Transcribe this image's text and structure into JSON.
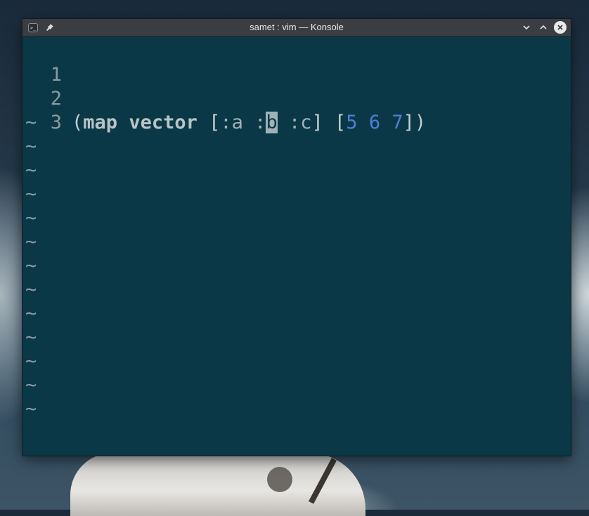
{
  "window": {
    "title": "samet : vim — Konsole",
    "app_icon": "terminal-icon",
    "pin_icon": "pin-icon",
    "minimize_icon": "chevron-down-icon",
    "maximize_icon": "chevron-up-icon",
    "close_icon": "close-icon"
  },
  "editor": {
    "line_numbers": [
      "1",
      "2",
      "3"
    ],
    "line2": {
      "open_paren": "(",
      "fn1": "map",
      "fn2": "vector",
      "open_bracket1": "[",
      "kw_a": ":a",
      "kw_b_colon": ":",
      "kw_b_cursor": "b",
      "kw_c": ":c",
      "close_bracket1": "]",
      "open_bracket2": "[",
      "n1": "5",
      "n2": "6",
      "n3": "7",
      "close_bracket2": "]",
      "close_paren": ")"
    },
    "tilde": "~",
    "colors": {
      "background": "#0a3846",
      "number": "#4f7fd9",
      "cursor": "#9fb3b7"
    }
  }
}
